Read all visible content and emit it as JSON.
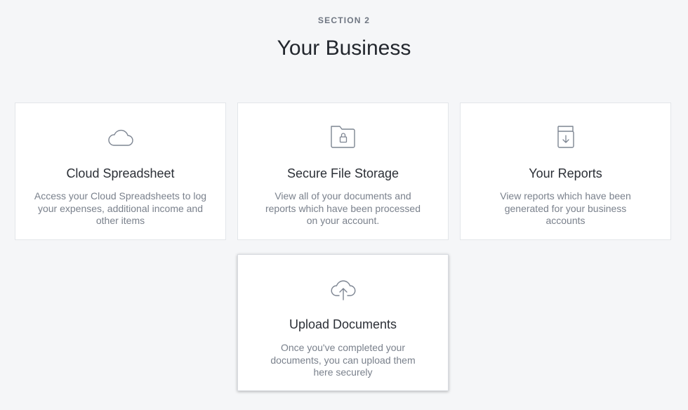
{
  "header": {
    "eyebrow": "SECTION 2",
    "title": "Your Business"
  },
  "cards": [
    {
      "title": "Cloud Spreadsheet",
      "description": "Access your Cloud Spreadsheets to log your expenses, additional income and other items",
      "icon": "cloud-icon"
    },
    {
      "title": "Secure File Storage",
      "description": "View all of your documents and reports which have been processed on your account.",
      "icon": "locked-folder-icon"
    },
    {
      "title": "Your Reports",
      "description": "View reports which have been generated for your business accounts",
      "icon": "report-download-icon"
    },
    {
      "title": "Upload Documents",
      "description": "Once you've completed your documents, you can upload them here securely",
      "icon": "cloud-upload-icon"
    }
  ],
  "colors": {
    "background": "#f5f6f8",
    "card": "#ffffff",
    "icon_stroke": "#7d8592",
    "title": "#2b2f36",
    "description": "#7a818c"
  }
}
